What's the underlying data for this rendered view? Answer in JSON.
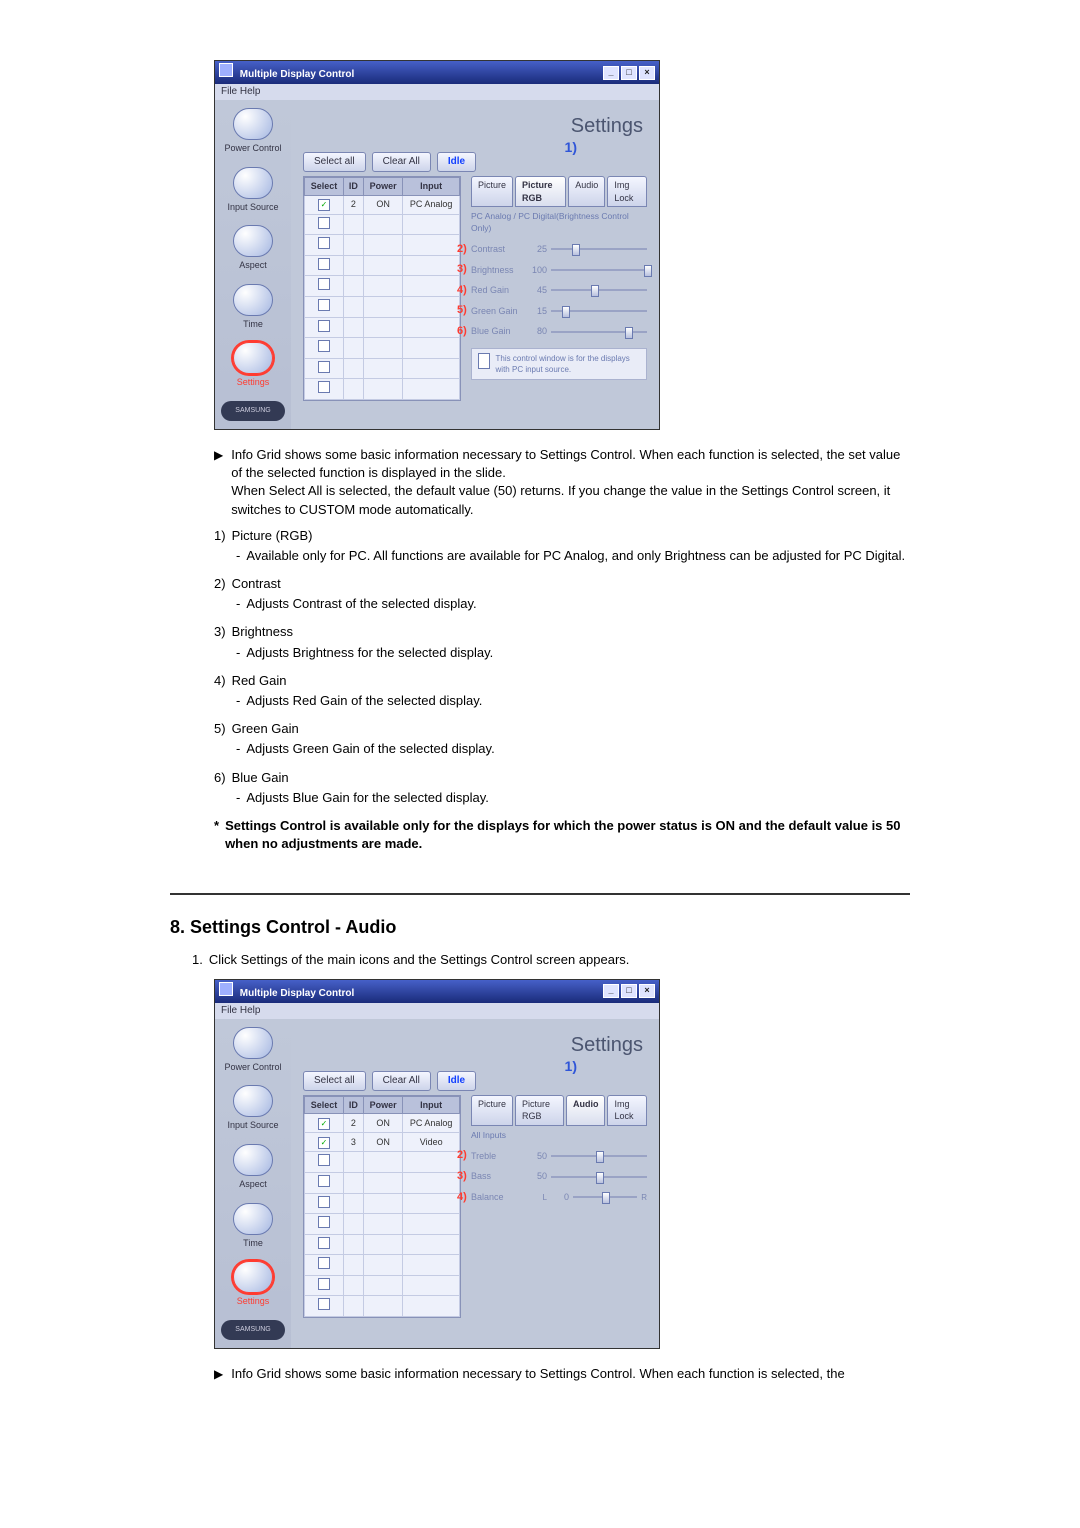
{
  "shot1": {
    "window_title": "Multiple Display Control",
    "menu": "File   Help",
    "heading": "Settings",
    "toolbar": {
      "select_all": "Select all",
      "clear_all": "Clear All",
      "idle": "Idle"
    },
    "callout1": "1)",
    "grid": {
      "headers": {
        "select": "Select",
        "id": "ID",
        "power": "Power",
        "input": "Input"
      },
      "rows": [
        {
          "checked": true,
          "id": "2",
          "power": "ON",
          "input": "PC Analog"
        },
        {
          "checked": false,
          "id": "",
          "power": "",
          "input": ""
        },
        {
          "checked": false,
          "id": "",
          "power": "",
          "input": ""
        },
        {
          "checked": false,
          "id": "",
          "power": "",
          "input": ""
        },
        {
          "checked": false,
          "id": "",
          "power": "",
          "input": ""
        },
        {
          "checked": false,
          "id": "",
          "power": "",
          "input": ""
        },
        {
          "checked": false,
          "id": "",
          "power": "",
          "input": ""
        },
        {
          "checked": false,
          "id": "",
          "power": "",
          "input": ""
        },
        {
          "checked": false,
          "id": "",
          "power": "",
          "input": ""
        },
        {
          "checked": false,
          "id": "",
          "power": "",
          "input": ""
        }
      ]
    },
    "tabs": {
      "picture": "Picture",
      "picture_rgb": "Picture RGB",
      "audio": "Audio",
      "img_lock": "Img Lock"
    },
    "subscope": "PC Analog / PC Digital(Brightness Control Only)",
    "sliders": {
      "s2": {
        "num": "2)",
        "label": "Contrast",
        "value": "25",
        "pos": 25
      },
      "s3": {
        "num": "3)",
        "label": "Brightness",
        "value": "100",
        "pos": 100
      },
      "s4": {
        "num": "4)",
        "label": "Red Gain",
        "value": "45",
        "pos": 45
      },
      "s5": {
        "num": "5)",
        "label": "Green Gain",
        "value": "15",
        "pos": 15
      },
      "s6": {
        "num": "6)",
        "label": "Blue Gain",
        "value": "80",
        "pos": 80
      }
    },
    "note": "This control window is for the displays with PC input source."
  },
  "sidebar": {
    "power": "Power Control",
    "input": "Input Source",
    "aspect": "Aspect",
    "time": "Time",
    "settings": "Settings",
    "logo": "SAMSUNG"
  },
  "shot2": {
    "window_title": "Multiple Display Control",
    "menu": "File   Help",
    "heading": "Settings",
    "toolbar": {
      "select_all": "Select all",
      "clear_all": "Clear All",
      "idle": "Idle"
    },
    "callout1": "1)",
    "grid": {
      "headers": {
        "select": "Select",
        "id": "ID",
        "power": "Power",
        "input": "Input"
      },
      "rows": [
        {
          "checked": true,
          "id": "2",
          "power": "ON",
          "input": "PC Analog"
        },
        {
          "checked": true,
          "id": "3",
          "power": "ON",
          "input": "Video"
        },
        {
          "checked": false,
          "id": "",
          "power": "",
          "input": ""
        },
        {
          "checked": false,
          "id": "",
          "power": "",
          "input": ""
        },
        {
          "checked": false,
          "id": "",
          "power": "",
          "input": ""
        },
        {
          "checked": false,
          "id": "",
          "power": "",
          "input": ""
        },
        {
          "checked": false,
          "id": "",
          "power": "",
          "input": ""
        },
        {
          "checked": false,
          "id": "",
          "power": "",
          "input": ""
        },
        {
          "checked": false,
          "id": "",
          "power": "",
          "input": ""
        },
        {
          "checked": false,
          "id": "",
          "power": "",
          "input": ""
        }
      ]
    },
    "tabs": {
      "picture": "Picture",
      "picture_rgb": "Picture RGB",
      "audio": "Audio",
      "img_lock": "Img Lock"
    },
    "subscope": "All Inputs",
    "sliders": {
      "s2": {
        "num": "2)",
        "label": "Treble",
        "value": "50",
        "pos": 50,
        "suffix": ""
      },
      "s3": {
        "num": "3)",
        "label": "Bass",
        "value": "50",
        "pos": 50,
        "suffix": ""
      },
      "s4": {
        "num": "4)",
        "label": "Balance",
        "value": "0",
        "pos": 50,
        "prefix": "L",
        "suffix": "R"
      }
    }
  },
  "doc": {
    "arrow1": "Info Grid shows some basic information necessary to Settings Control. When each function is selected, the set value of the selected function is displayed in the slide.",
    "arrow1b": "When Select All is selected, the default value (50) returns. If you change the value in the Settings Control screen, it switches to CUSTOM mode automatically.",
    "items": {
      "n1": "1)",
      "t1": "Picture (RGB)",
      "d1": "Available only for PC. All functions are available for PC Analog, and only Brightness can be adjusted for PC Digital.",
      "n2": "2)",
      "t2": "Contrast",
      "d2": "Adjusts Contrast of the selected display.",
      "n3": "3)",
      "t3": "Brightness",
      "d3": "Adjusts Brightness for the selected display.",
      "n4": "4)",
      "t4": "Red Gain",
      "d4": "Adjusts Red Gain of the selected display.",
      "n5": "5)",
      "t5": "Green Gain",
      "d5": "Adjusts Green Gain of the selected display.",
      "n6": "6)",
      "t6": "Blue Gain",
      "d6": "Adjusts Blue Gain for the selected display.",
      "star": "*",
      "starText": "Settings Control is available only for the displays for which the power status is ON and the default value is 50 when no adjustments are made."
    },
    "section8_title": "8. Settings Control - Audio",
    "section8_step1_num": "1.",
    "section8_step1": "Click Settings of the main icons and the Settings Control screen appears.",
    "arrow2": "Info Grid shows some basic information necessary to Settings Control. When each function is selected, the"
  }
}
